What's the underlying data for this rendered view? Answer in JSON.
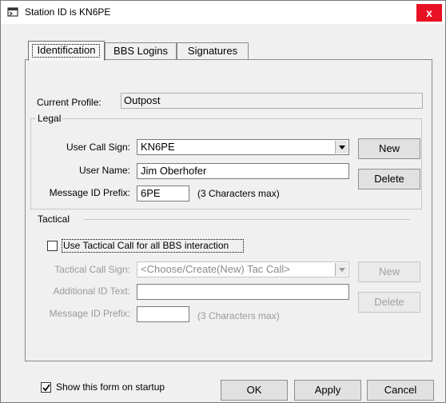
{
  "window": {
    "title": "Station ID is KN6PE",
    "close_label": "x"
  },
  "tabs": [
    {
      "label": "Identification"
    },
    {
      "label": "BBS Logins"
    },
    {
      "label": "Signatures"
    }
  ],
  "profile": {
    "label": "Current Profile:",
    "value": "Outpost"
  },
  "legal": {
    "title": "Legal",
    "call_sign_label": "User Call Sign:",
    "call_sign_value": "KN6PE",
    "user_name_label": "User Name:",
    "user_name_value": "Jim Oberhofer",
    "msg_prefix_label": "Message ID Prefix:",
    "msg_prefix_value": "6PE",
    "msg_prefix_hint": "(3 Characters max)",
    "new_label": "New",
    "delete_label": "Delete"
  },
  "tactical": {
    "title": "Tactical",
    "use_tactical_label": "Use Tactical Call for all BBS interaction",
    "use_tactical_checked": false,
    "call_sign_label": "Tactical Call Sign:",
    "call_sign_placeholder": "<Choose/Create(New) Tac Call>",
    "additional_id_label": "Additional ID Text:",
    "additional_id_value": "",
    "msg_prefix_label": "Message ID Prefix:",
    "msg_prefix_value": "",
    "msg_prefix_hint": "(3 Characters max)",
    "new_label": "New",
    "delete_label": "Delete"
  },
  "footer": {
    "show_on_startup_label": "Show this form on startup",
    "show_on_startup_checked": true,
    "ok_label": "OK",
    "apply_label": "Apply",
    "cancel_label": "Cancel"
  },
  "icons": [
    "window-icon",
    "close-icon",
    "dropdown-arrow-icon",
    "checkmark-icon"
  ]
}
